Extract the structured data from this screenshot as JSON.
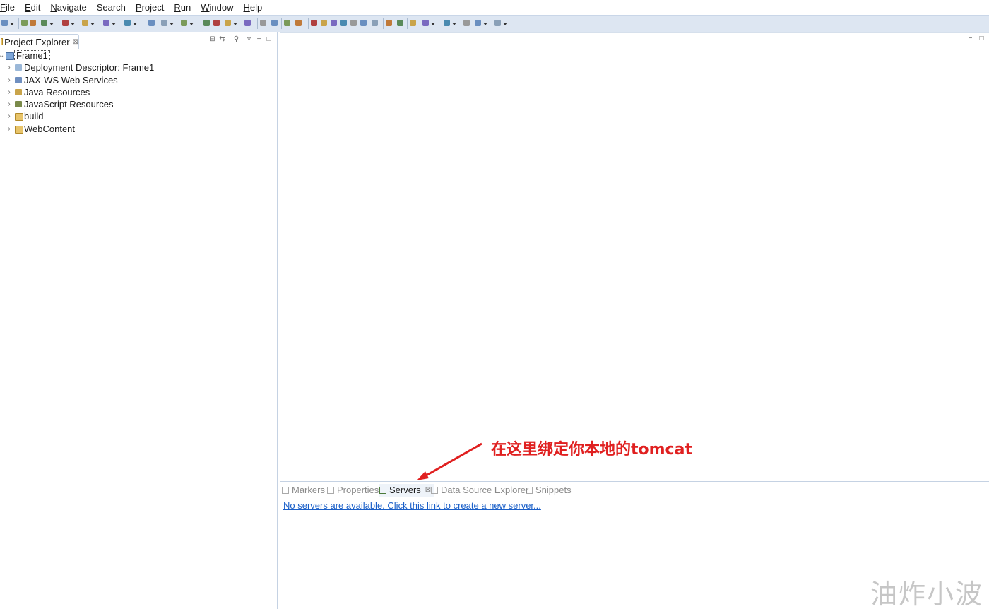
{
  "menubar": {
    "items": [
      "File",
      "Edit",
      "Navigate",
      "Search",
      "Project",
      "Run",
      "Window",
      "Help"
    ],
    "mnemonic_index": [
      0,
      0,
      0,
      -1,
      0,
      0,
      0,
      0
    ]
  },
  "project_explorer": {
    "tab_label": "Project Explorer",
    "close_glyph": "⊠",
    "root": "Frame1",
    "nodes": [
      {
        "label": "Deployment Descriptor: Frame1",
        "icon": "deployment-descriptor-icon"
      },
      {
        "label": "JAX-WS Web Services",
        "icon": "web-services-icon"
      },
      {
        "label": "Java Resources",
        "icon": "java-resources-icon"
      },
      {
        "label": "JavaScript Resources",
        "icon": "javascript-resources-icon"
      },
      {
        "label": "build",
        "icon": "folder-icon"
      },
      {
        "label": "WebContent",
        "icon": "folder-icon"
      }
    ]
  },
  "bottom_panel": {
    "tabs": [
      {
        "label": "Markers",
        "active": false
      },
      {
        "label": "Properties",
        "active": false
      },
      {
        "label": "Servers",
        "active": true
      },
      {
        "label": "Data Source Explorer",
        "active": false
      },
      {
        "label": "Snippets",
        "active": false
      }
    ],
    "servers_link": "No servers are available. Click this link to create a new server..."
  },
  "annotation": {
    "text": "在这里绑定你本地的tomcat",
    "color": "#e02020"
  },
  "watermark": "油炸小波",
  "colors": {
    "toolbar_bg": "#dde6f2",
    "link": "#1a5fc8",
    "annotation": "#e02020"
  }
}
